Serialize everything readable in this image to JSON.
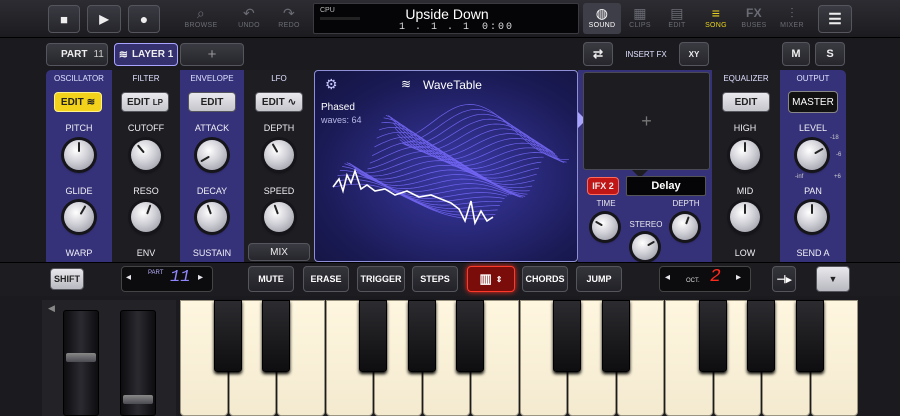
{
  "transport": {
    "stop": "■",
    "play": "▶",
    "record": "●"
  },
  "toolbar": [
    {
      "label": "BROWSE",
      "glyph": "⌕",
      "active": false
    },
    {
      "label": "UNDO",
      "glyph": "↶",
      "active": false
    },
    {
      "label": "REDO",
      "glyph": "↷",
      "active": false
    }
  ],
  "display": {
    "cpu": "CPU",
    "title": "Upside Down",
    "position": "1 . 1 . 1",
    "time": "0:00"
  },
  "views": [
    {
      "label": "SOUND",
      "glyph": "◍",
      "active": true
    },
    {
      "label": "CLIPS",
      "glyph": "▦",
      "active": false
    },
    {
      "label": "EDIT",
      "glyph": "▤",
      "active": false
    },
    {
      "label": "SONG",
      "glyph": "≡",
      "active": false
    },
    {
      "label": "BUSES",
      "glyph": "FX",
      "active": false
    },
    {
      "label": "MIXER",
      "glyph": "⫶",
      "active": false
    }
  ],
  "menu_glyph": "☰",
  "part": {
    "label": "PART",
    "number": "11"
  },
  "layer": {
    "label": "LAYER 1"
  },
  "add_layer": "+",
  "sections": {
    "oscillator": "OSCILLATOR",
    "filter": "FILTER",
    "envelope": "ENVELOPE",
    "lfo": "LFO",
    "insert_fx": "INSERT FX",
    "equalizer": "EQUALIZER",
    "output": "OUTPUT"
  },
  "edit_buttons": {
    "osc": "EDIT",
    "filter": "EDIT",
    "env": "EDIT",
    "lfo": "EDIT",
    "eq": "EDIT",
    "master": "MASTER"
  },
  "knob_labels": {
    "pitch": "PITCH",
    "cutoff": "CUTOFF",
    "attack": "ATTACK",
    "depth": "DEPTH",
    "glide": "GLIDE",
    "reso": "RESO",
    "decay": "DECAY",
    "speed": "SPEED",
    "warp": "WARP",
    "env": "ENV",
    "sustain": "SUSTAIN",
    "mix": "MIX",
    "high": "HIGH",
    "mid": "MID",
    "low": "LOW",
    "level": "LEVEL",
    "pan": "PAN",
    "send_a": "SEND A"
  },
  "level_scale": {
    "t1": "-18",
    "t2": "-6",
    "t3": "+6",
    "t4": "-inf",
    "t5": "+6"
  },
  "wavetable": {
    "title": "WaveTable",
    "preset": "Phased",
    "waves": "waves: 64"
  },
  "fx": {
    "add": "+",
    "slot": "IFX 2",
    "name": "Delay",
    "time": "TIME",
    "depth": "DEPTH",
    "stereo": "STEREO",
    "xy": "XY"
  },
  "mute_solo": {
    "m": "M",
    "s": "S"
  },
  "bottom_bar": {
    "shift": "SHIFT",
    "part_label": "PART",
    "part_value": "11",
    "mute": "MUTE",
    "erase": "ERASE",
    "trigger": "TRIGGER",
    "steps": "STEPS",
    "chords": "CHORDS",
    "jump": "JUMP",
    "oct_label": "OCT.",
    "oct_value": "2",
    "left_arrow": "◂",
    "right_arrow": "▸",
    "down": "▼"
  },
  "colors": {
    "accent_purple": "#3a347e",
    "edit_yellow": "#f2d21a",
    "wave_blue": "#6e62ff",
    "red_led": "#ff2a1e",
    "ifx_red": "#c01616"
  }
}
